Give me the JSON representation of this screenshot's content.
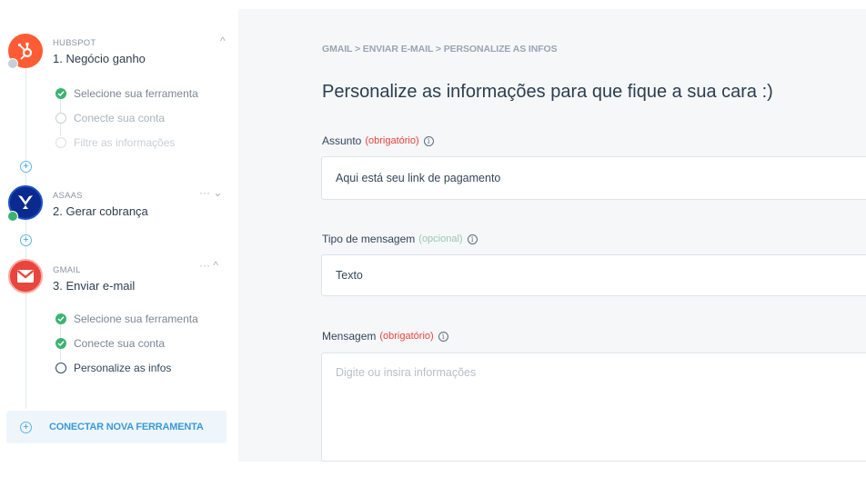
{
  "sidebar": {
    "steps": [
      {
        "kicker": "HUBSPOT",
        "name": "1. Negócio ganho",
        "icon": "hubspot-icon",
        "control": "^",
        "substeps": [
          {
            "label": "Selecione sua ferramenta",
            "state": "done"
          },
          {
            "label": "Conecte sua conta",
            "state": "todo"
          },
          {
            "label": "Filtre as informações",
            "state": "faded"
          }
        ]
      },
      {
        "kicker": "ASAAS",
        "name": "2. Gerar cobrança",
        "icon": "asaas-icon",
        "control": "··· ⌄"
      },
      {
        "kicker": "GMAIL",
        "name": "3. Enviar e-mail",
        "icon": "gmail-icon",
        "control": "··· ^",
        "substeps": [
          {
            "label": "Selecione sua ferramenta",
            "state": "done"
          },
          {
            "label": "Conecte sua conta",
            "state": "done"
          },
          {
            "label": "Personalize as infos",
            "state": "current"
          }
        ]
      }
    ],
    "connect_button": "CONECTAR NOVA FERRAMENTA"
  },
  "main": {
    "breadcrumb": "GMAIL > ENVIAR E-MAIL > PERSONALIZE AS INFOS",
    "title": "Personalize as informações para que fique a sua cara :)",
    "fields": [
      {
        "label": "Assunto",
        "hint": "(obrigatório)",
        "value": "Aqui está seu link de pagamento"
      },
      {
        "label": "Tipo de mensagem",
        "hint": "(opcional)",
        "value": "Texto"
      },
      {
        "label": "Mensagem",
        "hint": "(obrigatório)",
        "placeholder": "Digite ou insira informações"
      }
    ]
  },
  "colors": {
    "accent": "#3a9ad9",
    "hubspot": "#ff5c35",
    "asaas": "#0b2a8f",
    "gmail": "#e8453c",
    "done": "#3cb371",
    "required": "#e8453c"
  }
}
